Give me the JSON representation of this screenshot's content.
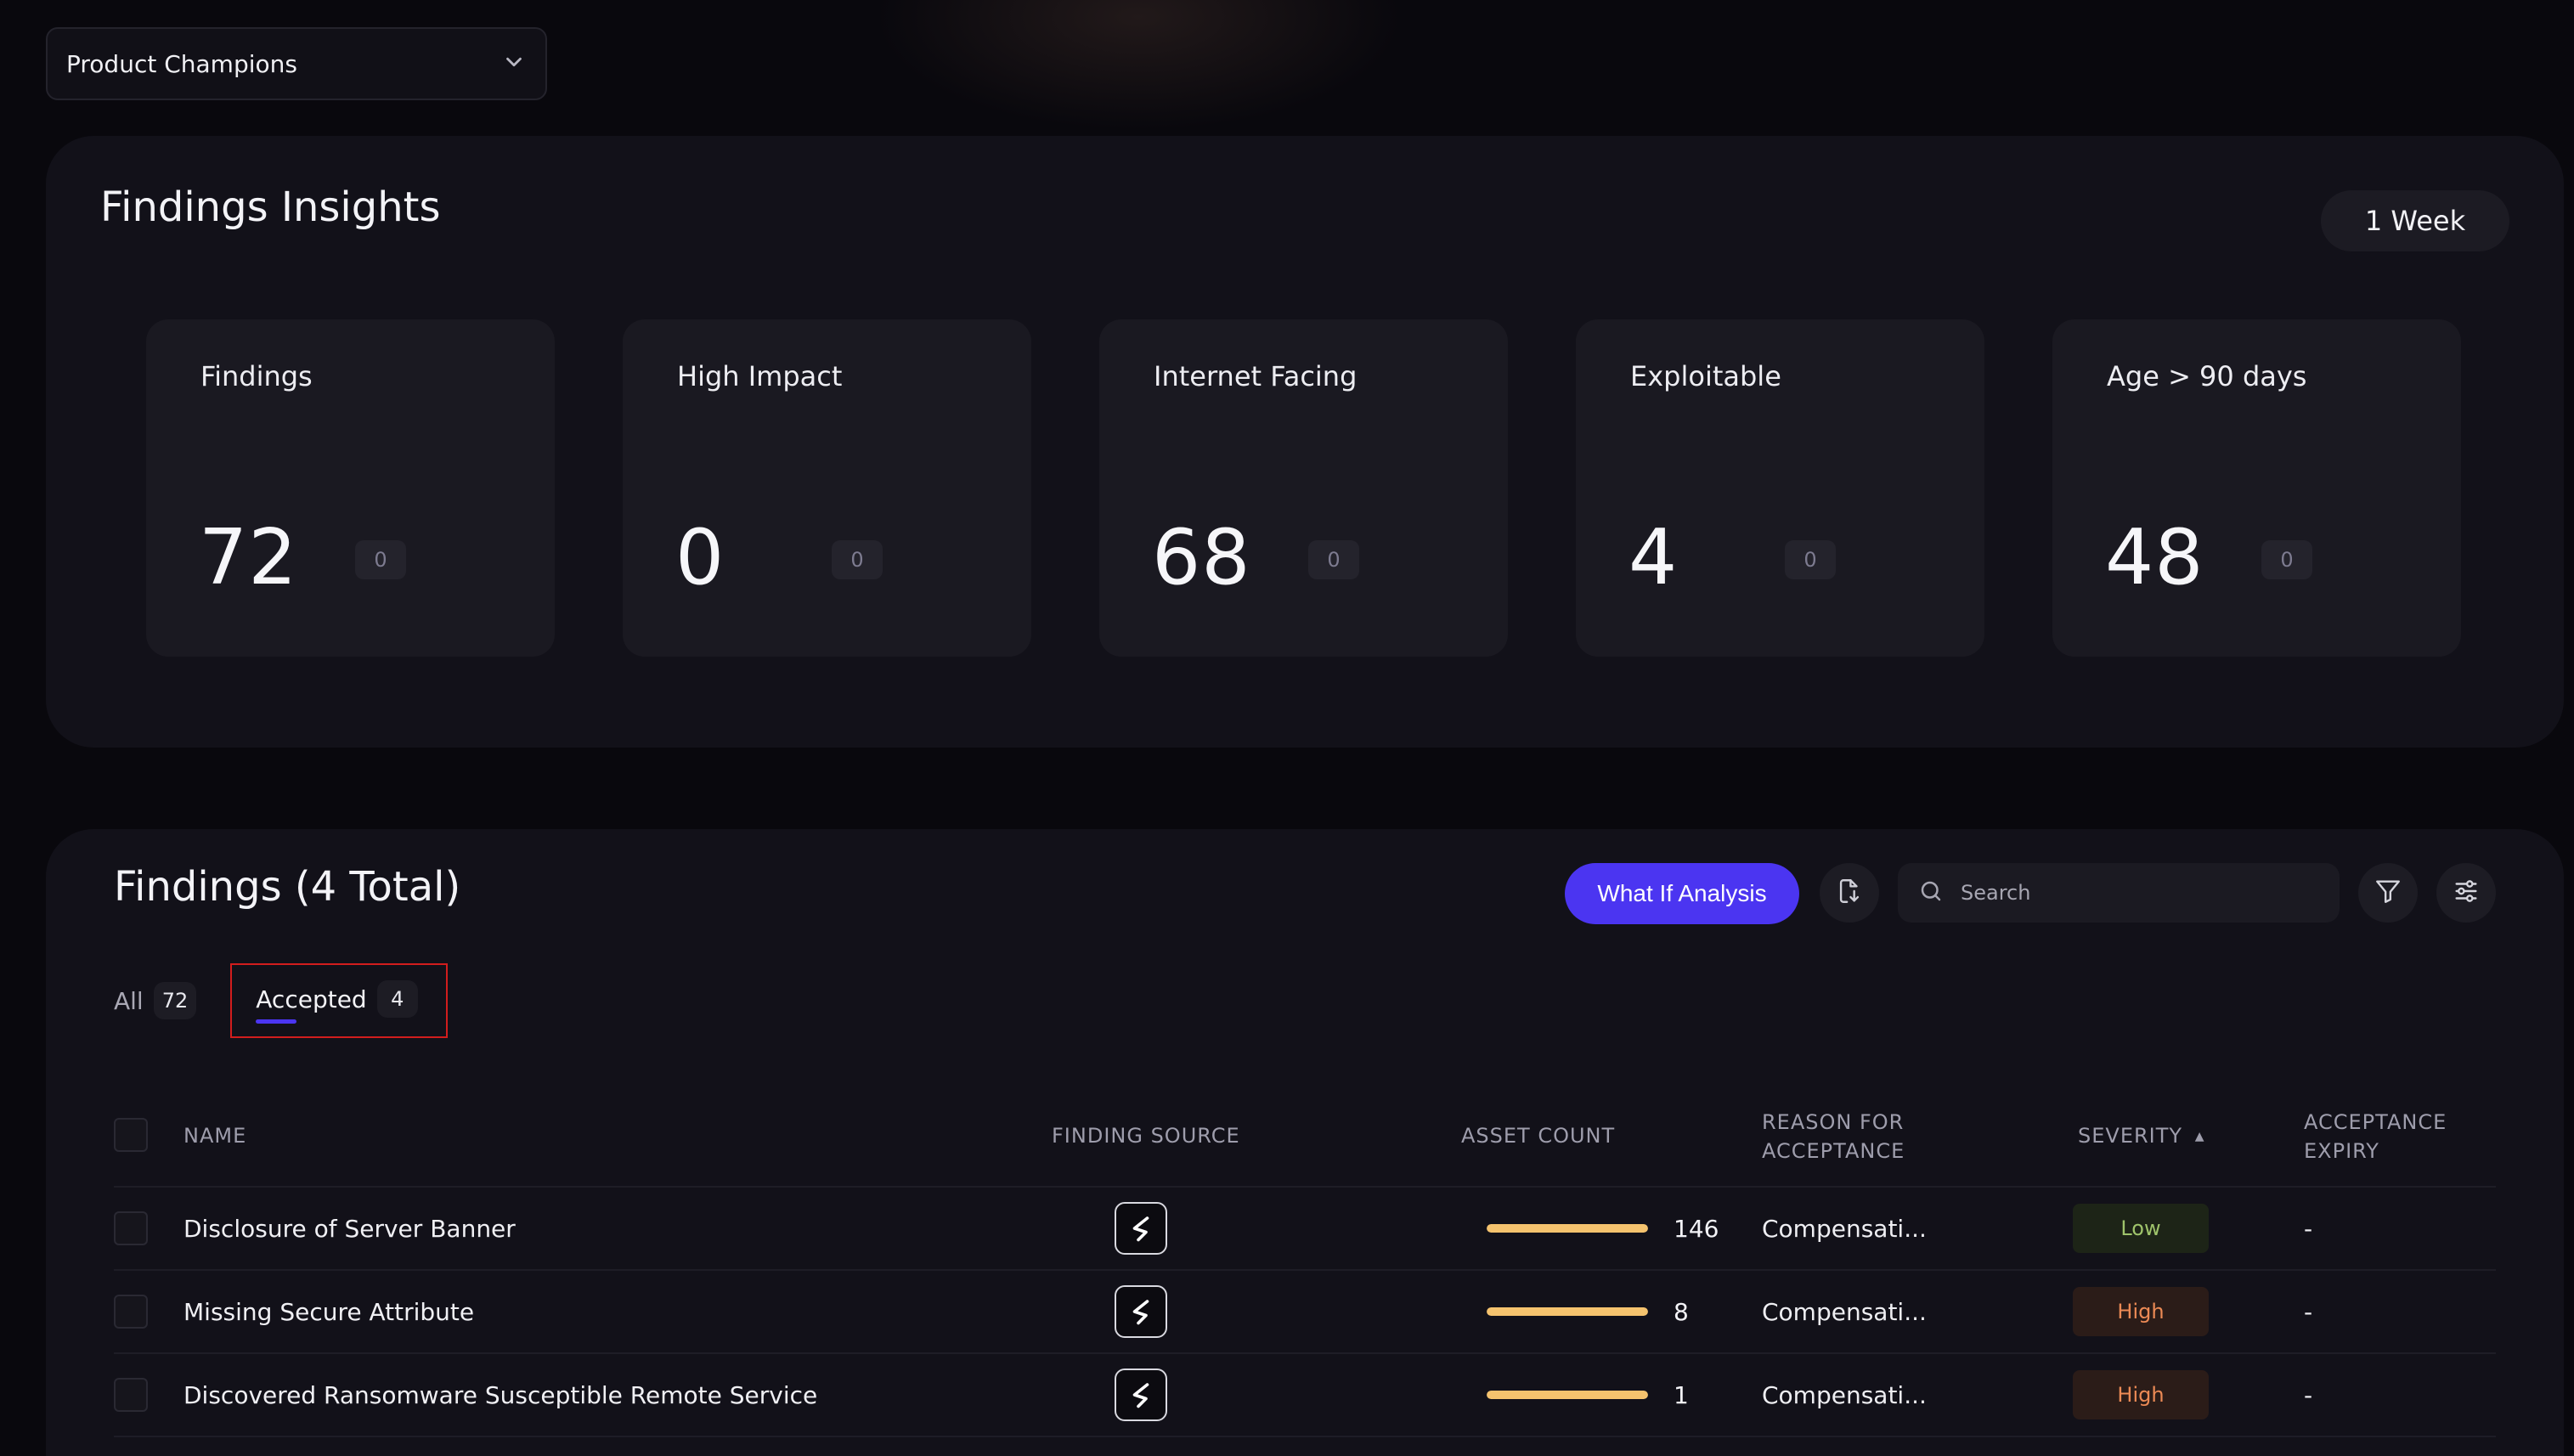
{
  "team_selector": {
    "label": "Product Champions"
  },
  "insights": {
    "title": "Findings Insights",
    "range": "1 Week",
    "cards": [
      {
        "label": "Findings",
        "value": "72",
        "delta": "0"
      },
      {
        "label": "High Impact",
        "value": "0",
        "delta": "0"
      },
      {
        "label": "Internet Facing",
        "value": "68",
        "delta": "0"
      },
      {
        "label": "Exploitable",
        "value": "4",
        "delta": "0"
      },
      {
        "label": "Age > 90 days",
        "value": "48",
        "delta": "0"
      }
    ]
  },
  "findings": {
    "title": "Findings (4 Total)",
    "what_if_label": "What If Analysis",
    "search_placeholder": "Search",
    "tabs": [
      {
        "label": "All",
        "count": "72"
      },
      {
        "label": "Accepted",
        "count": "4"
      }
    ],
    "columns": {
      "name": "NAME",
      "source": "FINDING SOURCE",
      "asset_count": "ASSET COUNT",
      "reason": "REASON FOR ACCEPTANCE",
      "severity": "SEVERITY",
      "expiry": "ACCEPTANCE EXPIRY"
    },
    "sort_indicator": "▲",
    "rows": [
      {
        "name": "Disclosure of Server Banner",
        "asset_count": "146",
        "asset_fill": 1.0,
        "reason": "Compensati...",
        "severity": "Low",
        "expiry": "-"
      },
      {
        "name": "Missing Secure Attribute",
        "asset_count": "8",
        "asset_fill": 1.0,
        "reason": "Compensati...",
        "severity": "High",
        "expiry": "-"
      },
      {
        "name": "Discovered Ransomware Susceptible Remote Service",
        "asset_count": "1",
        "asset_fill": 1.0,
        "reason": "Compensati...",
        "severity": "High",
        "expiry": "-"
      }
    ],
    "colors": {
      "accent": "#4b35f1",
      "bar": "#f5c36e",
      "low": "#9fc46b",
      "high": "#ec8a55"
    }
  }
}
